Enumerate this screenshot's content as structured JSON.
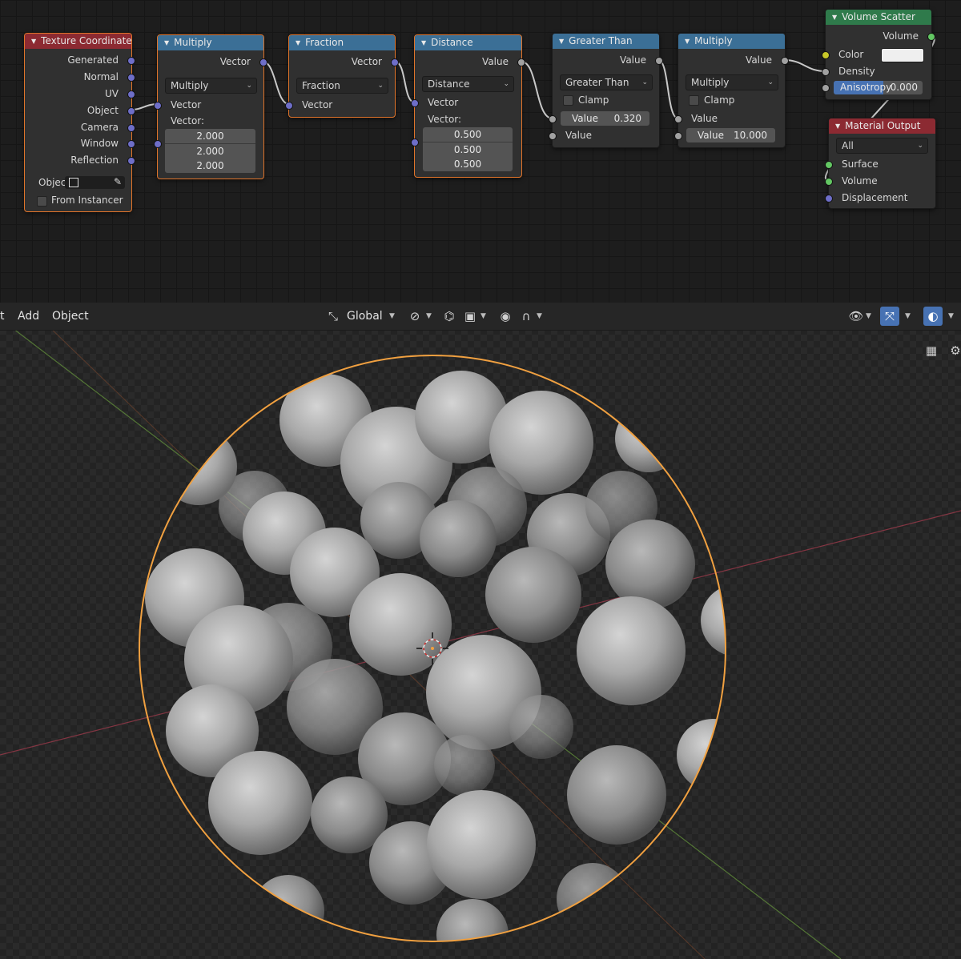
{
  "node_editor": {
    "nodes": {
      "texture_coordinate": {
        "title": "Texture Coordinate",
        "outputs": [
          "Generated",
          "Normal",
          "UV",
          "Object",
          "Camera",
          "Window",
          "Reflection"
        ],
        "object_label": "Objec",
        "from_instancer": "From Instancer"
      },
      "multiply_vec": {
        "title": "Multiply",
        "output": "Vector",
        "operation": "Multiply",
        "input": "Vector",
        "vector_label": "Vector:",
        "values": [
          "2.000",
          "2.000",
          "2.000"
        ]
      },
      "fraction": {
        "title": "Fraction",
        "output": "Vector",
        "operation": "Fraction",
        "input": "Vector"
      },
      "distance": {
        "title": "Distance",
        "output": "Value",
        "operation": "Distance",
        "input": "Vector",
        "vector_label": "Vector:",
        "values": [
          "0.500",
          "0.500",
          "0.500"
        ]
      },
      "greater_than": {
        "title": "Greater Than",
        "output": "Value",
        "operation": "Greater Than",
        "clamp": "Clamp",
        "value_label": "Value",
        "value": "0.320",
        "input": "Value"
      },
      "multiply_math": {
        "title": "Multiply",
        "output": "Value",
        "operation": "Multiply",
        "clamp": "Clamp",
        "input": "Value",
        "value_label": "Value",
        "value": "10.000"
      },
      "volume_scatter": {
        "title": "Volume Scatter",
        "output": "Volume",
        "color_label": "Color",
        "density_label": "Density",
        "anisotropy_label": "Anisotropy",
        "anisotropy_value": "0.000"
      },
      "material_output": {
        "title": "Material Output",
        "target": "All",
        "inputs": [
          "Surface",
          "Volume",
          "Displacement"
        ]
      }
    }
  },
  "viewport": {
    "menu": [
      "t",
      "Add",
      "Object"
    ],
    "transform_orientation": "Global"
  }
}
